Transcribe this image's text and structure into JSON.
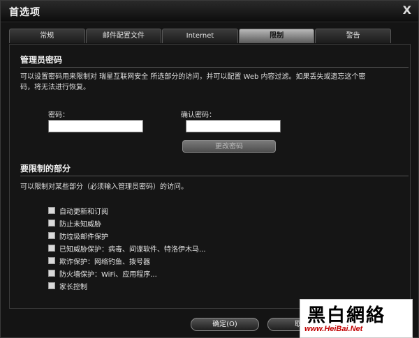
{
  "window": {
    "title": "首选项",
    "close_glyph": "X"
  },
  "tabs": [
    {
      "label": "常规"
    },
    {
      "label": "邮件配置文件"
    },
    {
      "label": "Internet"
    },
    {
      "label": "限制"
    },
    {
      "label": "警告"
    }
  ],
  "active_tab": "限制",
  "admin": {
    "title": "管理员密码",
    "desc_line1": "可以设置密码用来限制对 瑞星互联网安全 所选部分的访问，并可以配置 Web 内容过滤。如果丢失或遗忘这个密",
    "desc_line2": "码，将无法进行恢复。",
    "password_label": "密码：",
    "confirm_label": "确认密码：",
    "password_value": "",
    "confirm_value": "",
    "change_button": "更改密码"
  },
  "restrict": {
    "title": "要限制的部分",
    "desc": "可以限制对某些部分（必须输入管理员密码）的访问。",
    "items": [
      {
        "label": "自动更新和订阅",
        "checked": false
      },
      {
        "label": "防止未知威胁",
        "checked": false
      },
      {
        "label": "防垃圾邮件保护",
        "checked": false
      },
      {
        "label": "已知威胁保护：病毒、间谍软件、特洛伊木马...",
        "checked": false
      },
      {
        "label": "欺诈保护：网络钓鱼、拨号器",
        "checked": false
      },
      {
        "label": "防火墙保护：WiFi、应用程序...",
        "checked": false
      },
      {
        "label": "家长控制",
        "checked": false
      }
    ]
  },
  "footer": {
    "ok_label": "确定(O)",
    "cancel_label": "取消"
  },
  "watermark": {
    "title": "黑白網絡",
    "url": "www.HeiBai.Net"
  }
}
